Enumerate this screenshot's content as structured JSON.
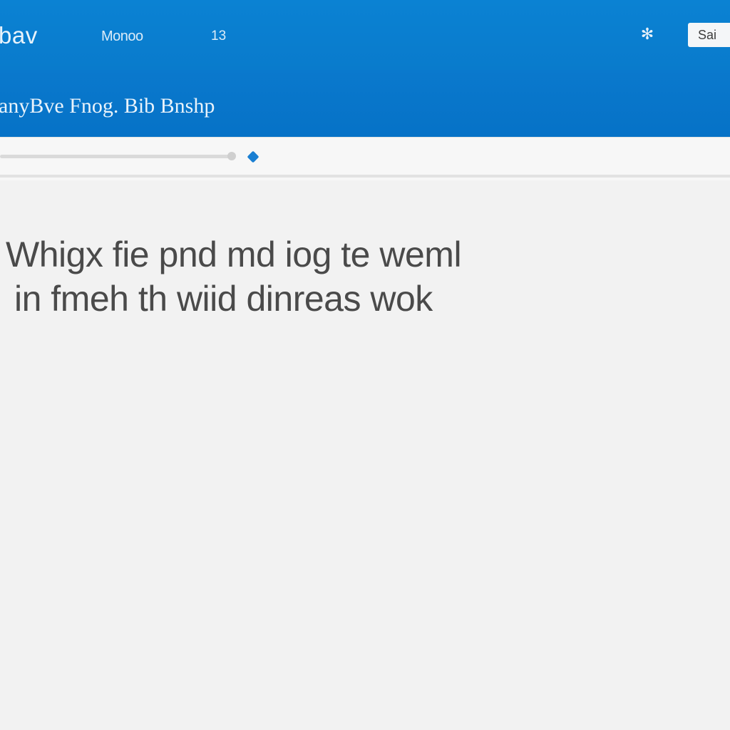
{
  "header": {
    "brand": "bav",
    "menu_label": "Monoo",
    "count": "13",
    "account_label": "Sai"
  },
  "icons": {
    "favorite": "star-icon",
    "slider_marker": "diamond-marker-icon"
  },
  "subheader": {
    "title": "anyBve Fnog. Bib Bnshp"
  },
  "content": {
    "headline_line1": "Whigx fie pnd md iog te weml",
    "headline_line2": "in fmeh th wiid dinreas wok"
  },
  "colors": {
    "primary": "#0a7fd0",
    "secondary": "#0776cb",
    "background": "#f2f2f2",
    "text": "#4a4a4a",
    "accent": "#1a7fd2"
  }
}
